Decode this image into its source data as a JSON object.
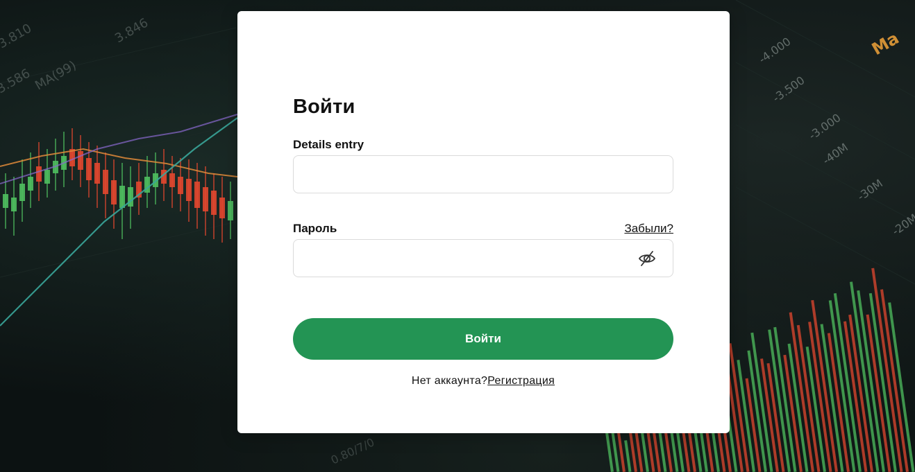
{
  "login_form": {
    "title": "Войти",
    "login_label": "Details entry",
    "login_value": "",
    "password_label": "Пароль",
    "forgot_link": "Забыли?",
    "password_value": "",
    "password_visibility_icon": "eye-off-icon",
    "submit_label": "Войти",
    "no_account_text": "Нет аккаунта?",
    "register_link": "Регистрация"
  },
  "background": {
    "axis_labels_left": [
      "3.810",
      "3.846",
      "MA(99)",
      "3.586"
    ],
    "axis_labels_right": [
      "-4.000",
      "-3.500",
      "-3.000",
      "-40M",
      "-30M",
      "-20M"
    ],
    "corner_text": "Ma",
    "bottom_text": "0.80/7/0"
  },
  "colors": {
    "accent_green": "#239454",
    "candle_green": "#4fbf5f",
    "candle_red": "#e2472f",
    "ma_line_teal": "#3aa69a",
    "ma_line_orange": "#e08a3a"
  }
}
